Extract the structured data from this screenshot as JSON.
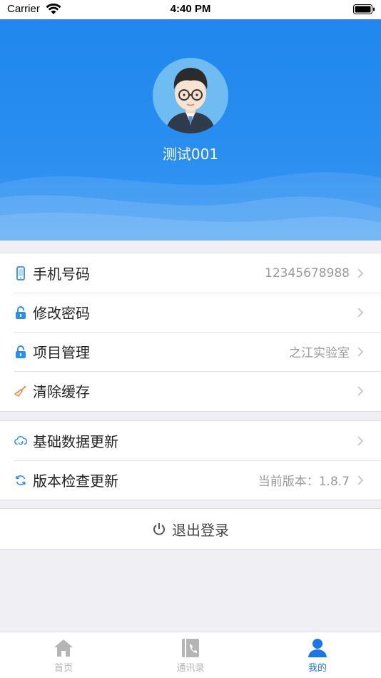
{
  "status_bar": {
    "carrier": "Carrier",
    "time": "4:40 PM"
  },
  "profile": {
    "name": "测试001"
  },
  "menu_group_1": [
    {
      "label": "手机号码",
      "value": "12345678988",
      "icon": "phone-icon"
    },
    {
      "label": "修改密码",
      "value": "",
      "icon": "lock-icon"
    },
    {
      "label": "项目管理",
      "value": "之江实验室",
      "icon": "lock-icon"
    },
    {
      "label": "清除缓存",
      "value": "",
      "icon": "broom-icon"
    }
  ],
  "menu_group_2": [
    {
      "label": "基础数据更新",
      "value": "",
      "icon": "cloud-sync-icon"
    },
    {
      "label": "版本检查更新",
      "value": "当前版本：1.8.7",
      "icon": "refresh-icon"
    }
  ],
  "logout": {
    "label": "退出登录",
    "icon": "power-icon"
  },
  "tab_bar": [
    {
      "label": "首页",
      "icon": "home-icon",
      "active": false
    },
    {
      "label": "通讯录",
      "icon": "contacts-icon",
      "active": false
    },
    {
      "label": "我的",
      "icon": "user-icon",
      "active": true
    }
  ],
  "colors": {
    "accent": "#1a78e6",
    "header": "#2a8ef0",
    "inactive": "#b5b5b5"
  }
}
